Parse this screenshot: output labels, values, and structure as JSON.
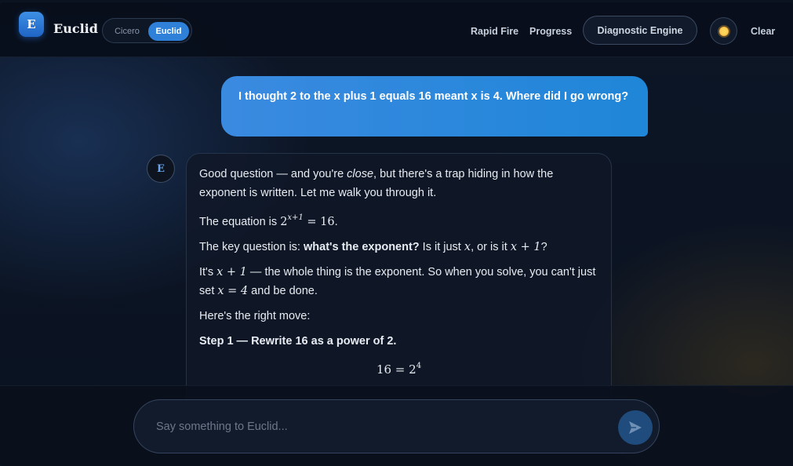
{
  "header": {
    "logo_letter": "E",
    "brand": "Euclid",
    "modes": [
      "Cicero",
      "Euclid"
    ],
    "active_mode": "Euclid",
    "nav": [
      "Rapid Fire",
      "Progress"
    ],
    "diagnostic_button": "Diagnostic Engine",
    "theme_icon": "sun-icon",
    "clear": "Clear"
  },
  "chat": {
    "user_message": "I thought 2 to the x plus 1 equals 16 meant x is 4. Where did I go wrong?",
    "assistant_avatar": "E",
    "assistant": {
      "p1_a": "Good question — and you're ",
      "p1_em": "close",
      "p1_b": ", but there's a trap hiding in how the exponent is written. Let me walk you through it.",
      "p2_a": "The equation is ",
      "p2_base": "2",
      "p2_exp": "x+1",
      "p2_rhs": " = 16",
      "p2_end": ".",
      "p3_a": "The key question is: ",
      "p3_strong": "what's the exponent?",
      "p3_b": " Is it just ",
      "p3_m1": "x",
      "p3_c": ", or is it ",
      "p3_m2": "x + 1",
      "p3_d": "?",
      "p4_a": "It's ",
      "p4_m1": "x + 1",
      "p4_b": " — the whole thing is the exponent. So when you solve, you can't just set ",
      "p4_m2": "x = 4",
      "p4_c": " and be done.",
      "p5": "Here's the right move:",
      "step1": "Step 1 — Rewrite 16 as a power of 2.",
      "eq_lhs": "16 = 2",
      "eq_exp": "4"
    }
  },
  "composer": {
    "placeholder": "Say something to Euclid...",
    "send_icon": "send-icon"
  }
}
